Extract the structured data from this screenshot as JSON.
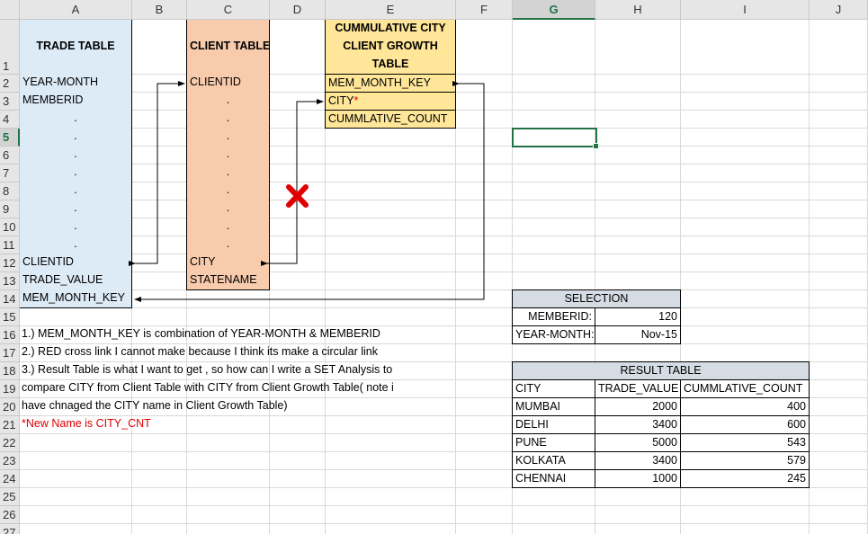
{
  "column_headers": [
    "A",
    "B",
    "C",
    "D",
    "E",
    "F",
    "G",
    "H",
    "I",
    "J"
  ],
  "row_headers": [
    "1",
    "2",
    "3",
    "4",
    "5",
    "6",
    "7",
    "8",
    "9",
    "10",
    "11",
    "12",
    "13",
    "14",
    "15",
    "16",
    "17",
    "18",
    "19",
    "20",
    "21",
    "22",
    "23",
    "24",
    "25",
    "26",
    "27"
  ],
  "selected_cell": "G5",
  "trade_table": {
    "title": "TRADE TABLE",
    "fields": [
      "YEAR-MONTH",
      "MEMBERID",
      ".",
      ".",
      ".",
      ".",
      ".",
      ".",
      ".",
      ".",
      "CLIENTID",
      "TRADE_VALUE",
      "MEM_MONTH_KEY"
    ]
  },
  "client_table": {
    "title": "CLIENT TABLE",
    "fields": [
      "CLIENTID",
      ".",
      ".",
      ".",
      ".",
      ".",
      ".",
      ".",
      ".",
      ".",
      "CITY",
      "STATENAME"
    ]
  },
  "growth_table": {
    "title": "CUMMULATIVE CITY CLIENT GROWTH TABLE",
    "fields": [
      "MEM_MONTH_KEY",
      "CITY",
      "CUMMLATIVE_COUNT"
    ],
    "city_marker": "*"
  },
  "notes": [
    "1.) MEM_MONTH_KEY is combination of YEAR-MONTH & MEMBERID",
    "2.) RED cross link I cannot make because I think its make a circular link",
    "3.) Result Table is what I want to get , so how can I write a SET Analysis to",
    "compare CITY from Client Table with CITY from Client Growth Table( note i",
    "have chnaged the CITY name in Client Growth Table)",
    "*New Name is CITY_CNT"
  ],
  "selection": {
    "title": "SELECTION",
    "memberid_label": "MEMBERID:",
    "memberid_value": "120",
    "yearmonth_label": "YEAR-MONTH:",
    "yearmonth_value": "Nov-15"
  },
  "result_table": {
    "title": "RESULT TABLE",
    "headers": [
      "CITY",
      "TRADE_VALUE",
      "CUMMLATIVE_COUNT"
    ],
    "rows": [
      [
        "MUMBAI",
        "2000",
        "400"
      ],
      [
        "DELHI",
        "3400",
        "600"
      ],
      [
        "PUNE",
        "5000",
        "543"
      ],
      [
        "KOLKATA",
        "3400",
        "579"
      ],
      [
        "CHENNAI",
        "1000",
        "245"
      ]
    ]
  },
  "colors": {
    "trade": "#ddebf7",
    "client": "#f8cbad",
    "growth": "#ffe699",
    "cross": "#e00000"
  }
}
